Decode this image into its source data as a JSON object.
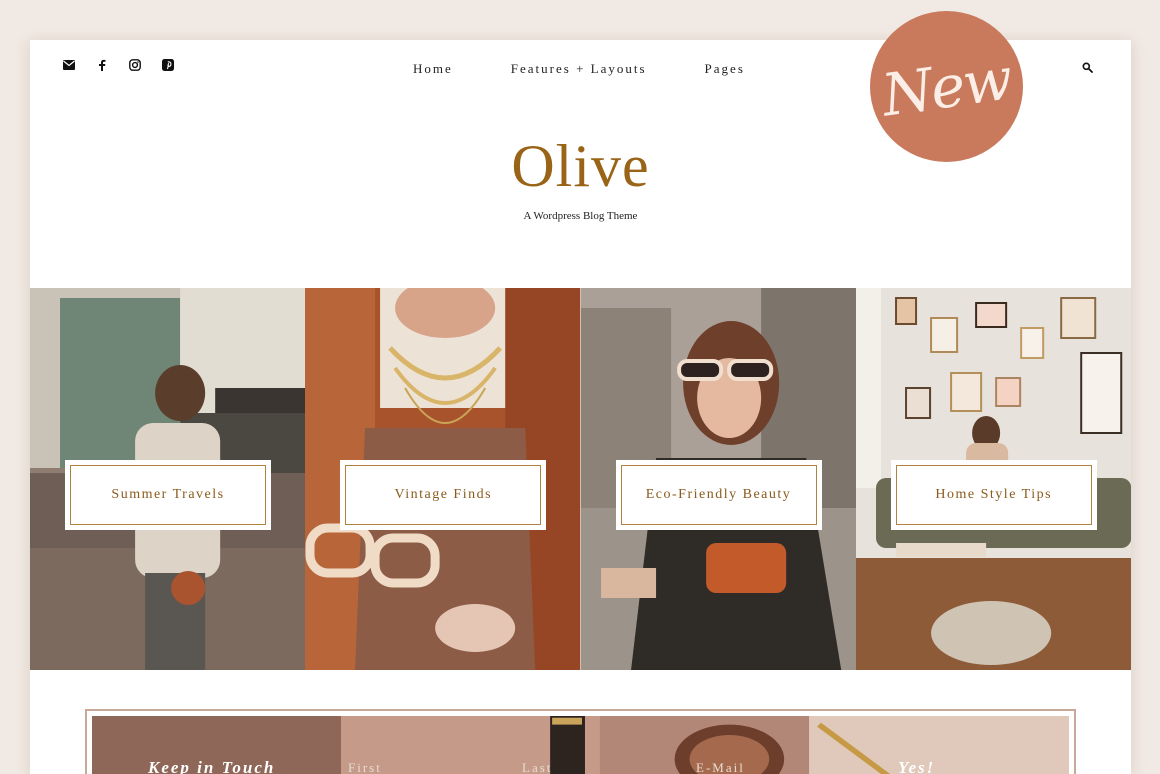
{
  "social": [
    {
      "name": "email-icon"
    },
    {
      "name": "facebook-icon"
    },
    {
      "name": "instagram-icon"
    },
    {
      "name": "pinterest-icon"
    }
  ],
  "nav": {
    "items": [
      {
        "label": "Home"
      },
      {
        "label": "Features + Layouts"
      },
      {
        "label": "Pages"
      }
    ]
  },
  "header": {
    "logo": "Olive",
    "tagline": "A Wordpress Blog Theme"
  },
  "badge": {
    "text": "New"
  },
  "categories": [
    {
      "label": "Summer Travels"
    },
    {
      "label": "Vintage Finds"
    },
    {
      "label": "Eco-Friendly Beauty"
    },
    {
      "label": "Home Style Tips"
    }
  ],
  "newsletter": {
    "title": "Keep in Touch",
    "first_placeholder": "First",
    "last_placeholder": "Last",
    "email_placeholder": "E-Mail",
    "submit_label": "Yes!"
  },
  "colors": {
    "accent": "#9a6418",
    "badge": "#c97a5d",
    "page_bg": "#f1e9e3"
  }
}
